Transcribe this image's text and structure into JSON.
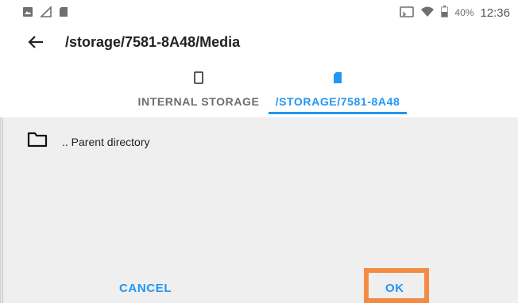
{
  "statusbar": {
    "battery_text": "40%",
    "time": "12:36",
    "icons_left": [
      "image-icon",
      "signal-triangle-icon",
      "sdcard-icon"
    ],
    "icons_right": [
      "cast-screen-icon",
      "wifi-icon",
      "battery-icon"
    ]
  },
  "header": {
    "title": "/storage/7581-8A48/Media",
    "back_icon": "arrow-left-icon"
  },
  "tabs": [
    {
      "label": "INTERNAL STORAGE",
      "icon": "phone-icon",
      "selected": false
    },
    {
      "label": "/STORAGE/7581-8A48",
      "icon": "sdcard-icon",
      "selected": true
    }
  ],
  "list": {
    "items": [
      {
        "label": ".. Parent directory",
        "icon": "folder-icon"
      }
    ]
  },
  "dialog": {
    "cancel_label": "CANCEL",
    "ok_label": "OK"
  },
  "colors": {
    "accent": "#2196f3",
    "highlight": "#f28c45",
    "content_bg": "#efefef"
  }
}
